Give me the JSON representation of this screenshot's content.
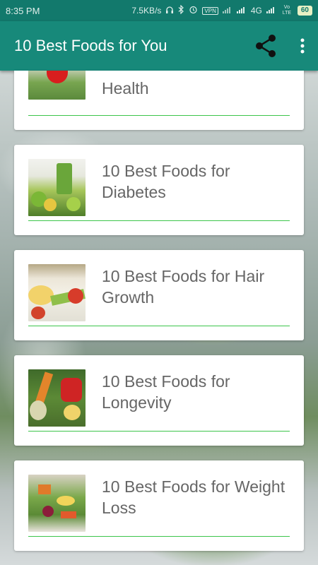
{
  "status": {
    "time": "8:35 PM",
    "speed": "7.5KB/s",
    "vpn": "VPN",
    "network": "4G",
    "volte": "Vo LTE",
    "battery": "60"
  },
  "appbar": {
    "title": "10 Best Foods for You"
  },
  "list": [
    {
      "title": "Health"
    },
    {
      "title": "10 Best Foods for Diabetes"
    },
    {
      "title": "10 Best Foods for Hair Growth"
    },
    {
      "title": "10 Best Foods for Longevity"
    },
    {
      "title": "10 Best Foods for Weight Loss"
    }
  ],
  "colors": {
    "statusbar": "#12796c",
    "appbar": "#17897a",
    "divider": "#3cc54a",
    "title_text": "#666666"
  }
}
